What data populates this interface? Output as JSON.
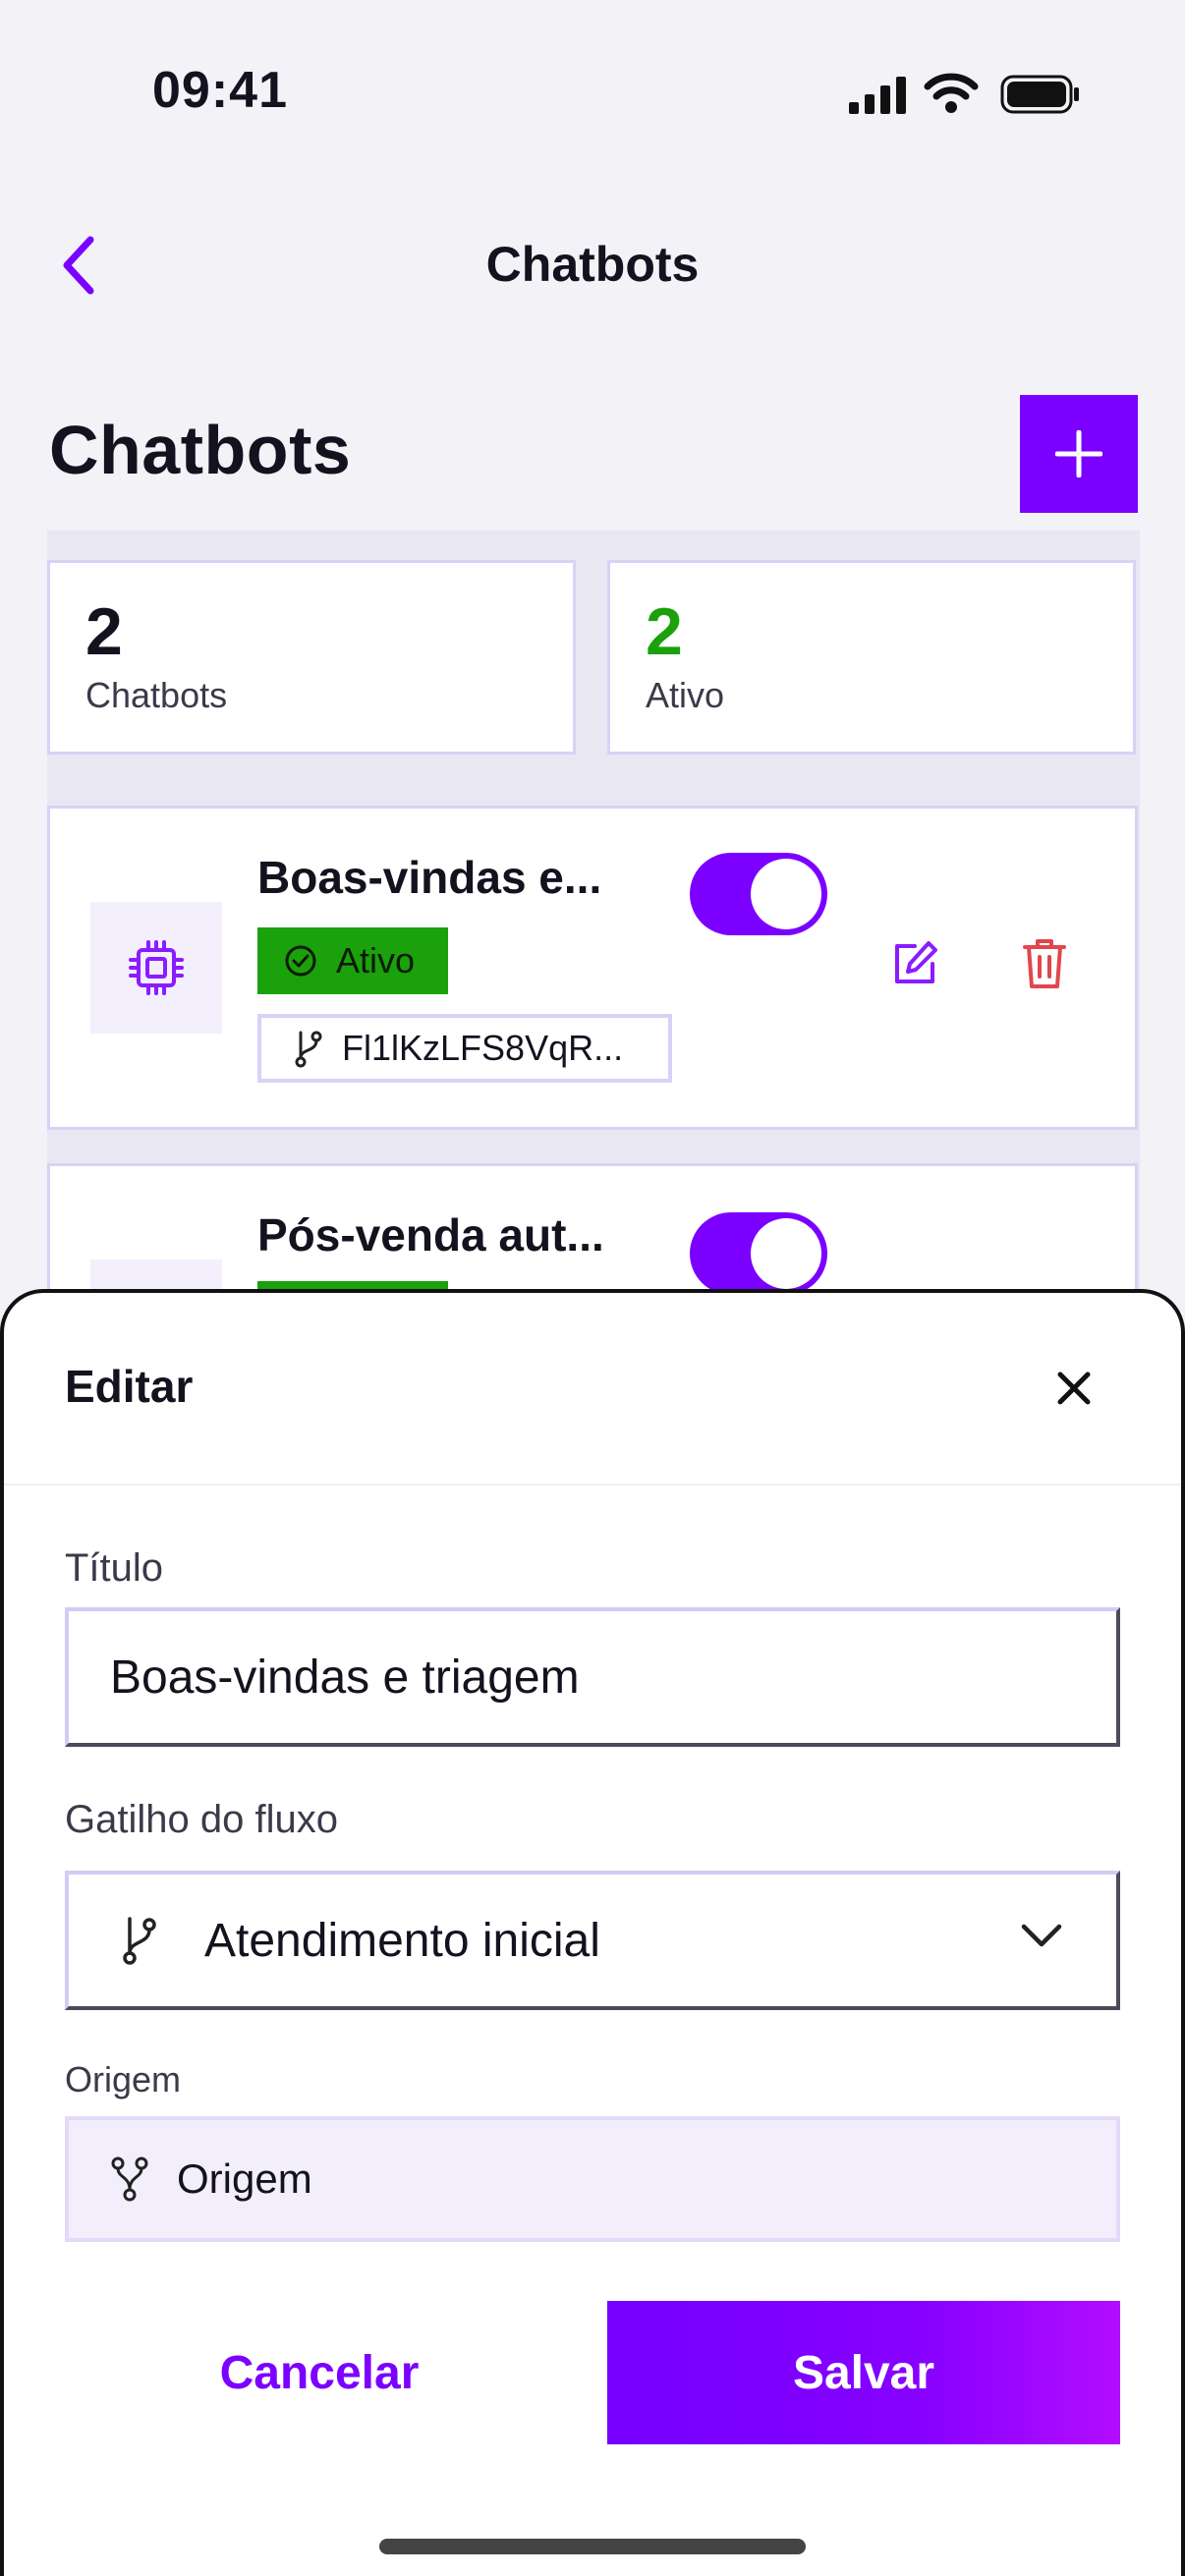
{
  "status_bar": {
    "time": "09:41"
  },
  "nav": {
    "title": "Chatbots"
  },
  "page": {
    "title": "Chatbots"
  },
  "stats": [
    {
      "value": "2",
      "label": "Chatbots",
      "value_color": "#14121f"
    },
    {
      "value": "2",
      "label": "Ativo",
      "value_color": "#1aa10b"
    }
  ],
  "bots": [
    {
      "title": "Boas-vindas e...",
      "status": "Ativo",
      "flow_id": "Fl1lKzLFS8VqR...",
      "enabled": true
    },
    {
      "title": "Pós-venda aut...",
      "enabled": true
    }
  ],
  "sheet": {
    "title": "Editar",
    "title_label": "Título",
    "title_value": "Boas-vindas e triagem",
    "trigger_label": "Gatilho do fluxo",
    "trigger_value": "Atendimento inicial",
    "origin_label": "Origem",
    "origin_value": "Origem",
    "cancel_label": "Cancelar",
    "save_label": "Salvar"
  },
  "colors": {
    "accent": "#7b00ff",
    "success": "#1aa10b",
    "danger": "#e0474c"
  }
}
